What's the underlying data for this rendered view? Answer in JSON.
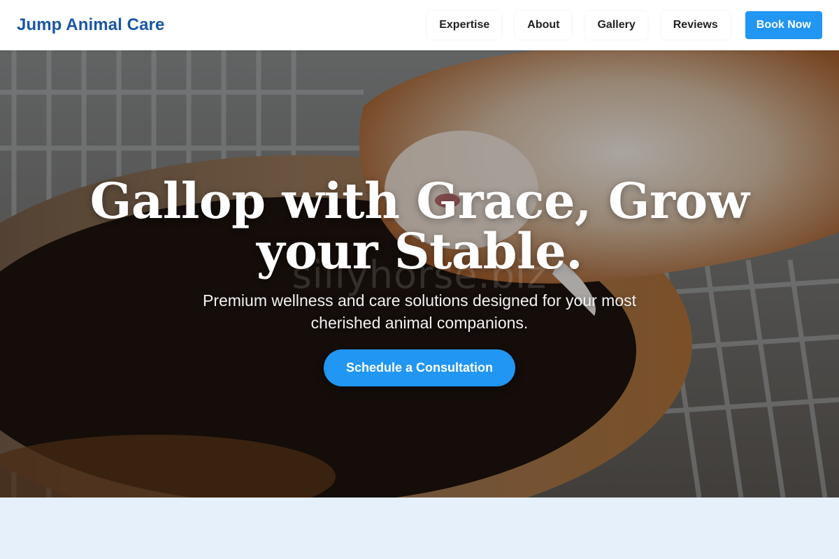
{
  "header": {
    "brand": "Jump Animal Care",
    "nav": [
      "Expertise",
      "About",
      "Gallery",
      "Reviews"
    ],
    "cta": "Book Now"
  },
  "hero": {
    "title": "Gallop with Grace, Grow your Stable.",
    "watermark": "sillyhorse.biz",
    "subtitle": "Premium wellness and care solutions designed for your most cherished animal companions.",
    "cta": "Schedule a Consultation"
  },
  "next_section": {
    "title": ""
  },
  "colors": {
    "brand": "#1a56a6",
    "accent": "#2196f3",
    "section_bg": "#e6f0fb"
  }
}
